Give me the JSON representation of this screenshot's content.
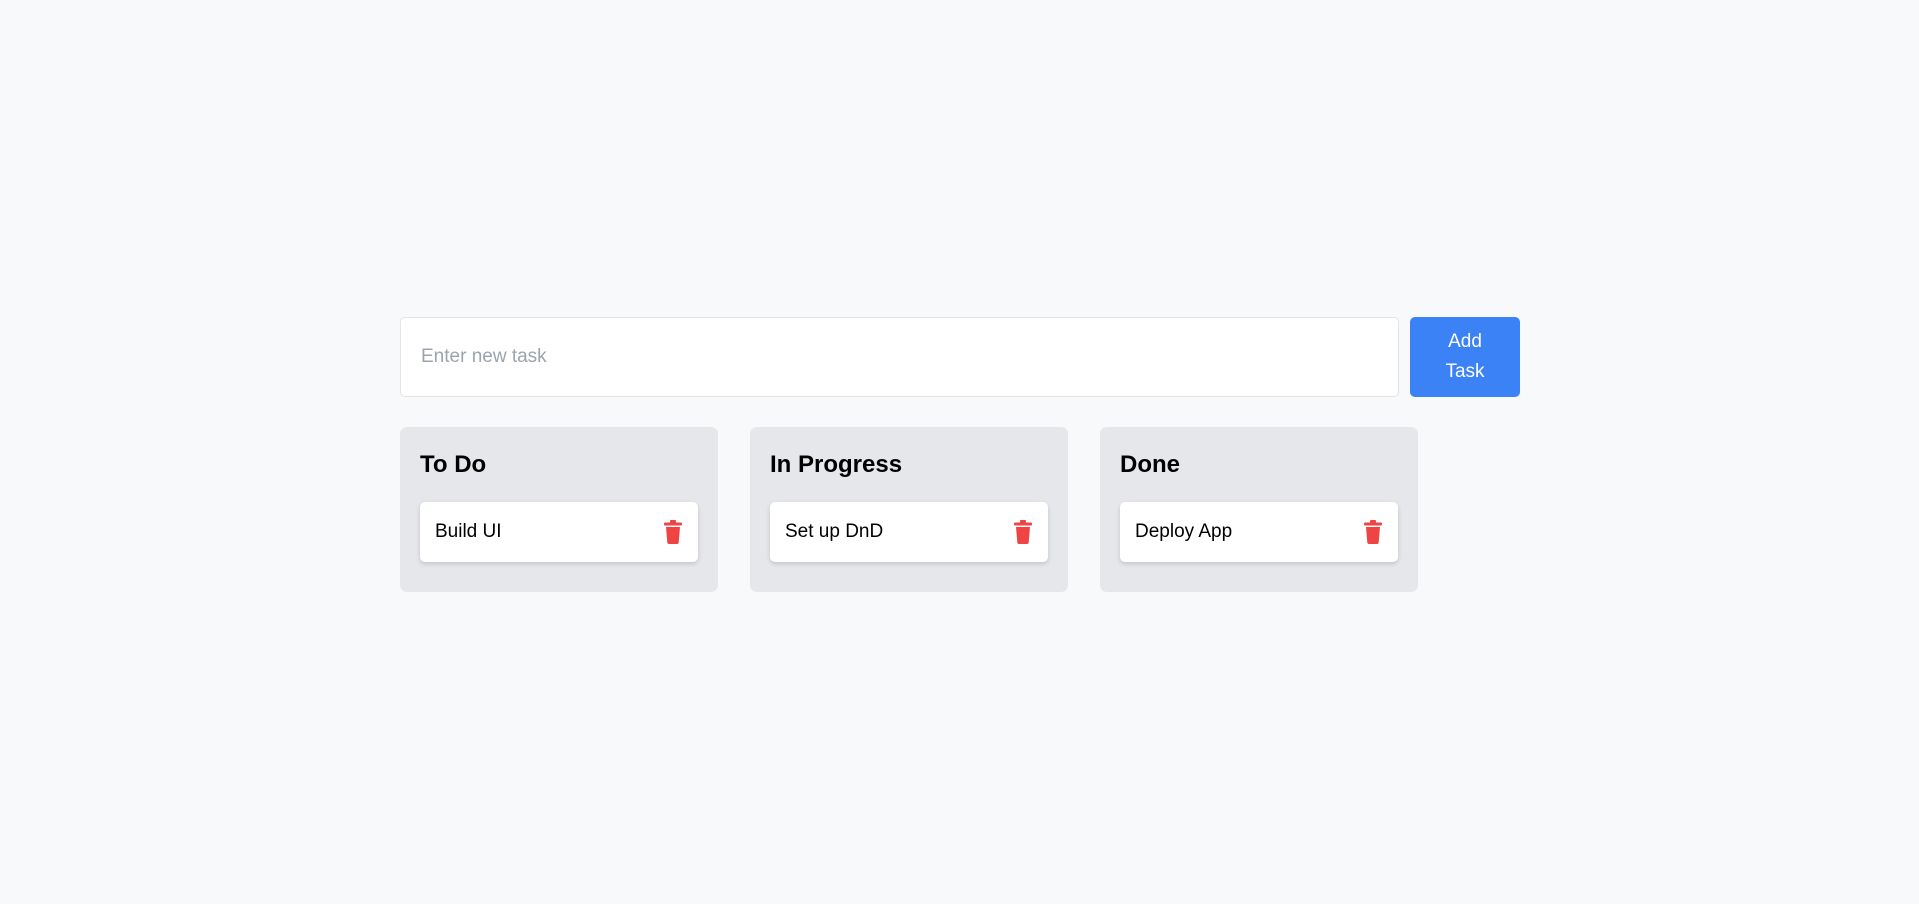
{
  "form": {
    "placeholder": "Enter new task",
    "value": "",
    "add_label": "Add Task"
  },
  "colors": {
    "accent": "#3b82f6",
    "delete": "#ef4444",
    "column_bg": "#e5e7eb"
  },
  "columns": [
    {
      "title": "To Do",
      "tasks": [
        {
          "text": "Build UI",
          "icon": "trash-icon"
        }
      ]
    },
    {
      "title": "In Progress",
      "tasks": [
        {
          "text": "Set up DnD",
          "icon": "trash-icon"
        }
      ]
    },
    {
      "title": "Done",
      "tasks": [
        {
          "text": "Deploy App",
          "icon": "trash-icon"
        }
      ]
    }
  ]
}
